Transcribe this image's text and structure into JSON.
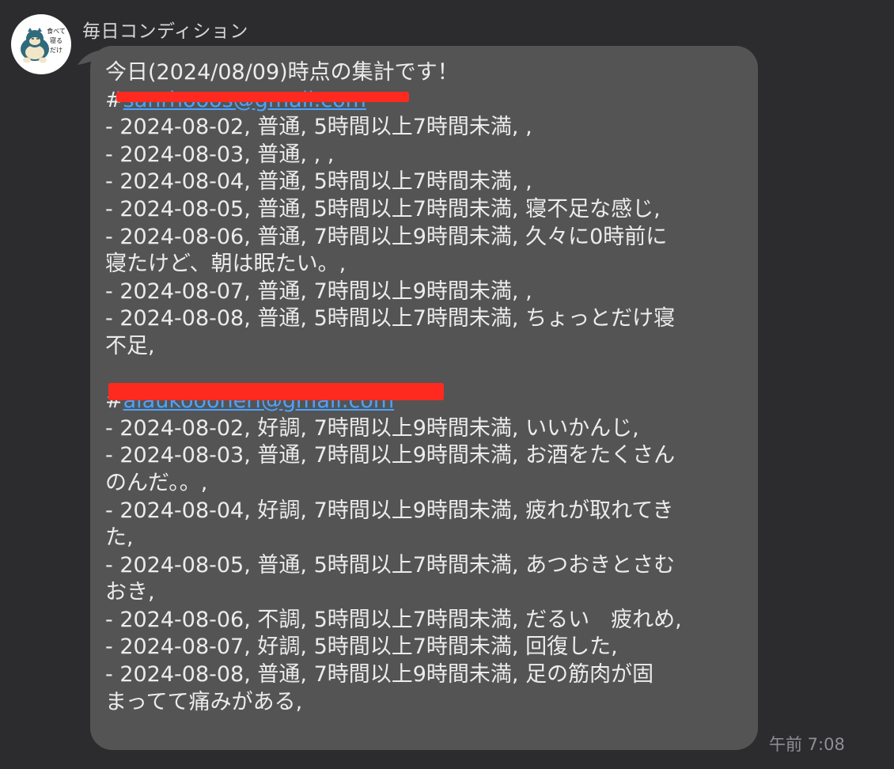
{
  "sender": {
    "name": "毎日コンディション",
    "avatar_icon": "sleeping-bear-character-icon",
    "avatar_text": "食べて寝るだけ"
  },
  "message": {
    "lines": [
      {
        "text": "今日(2024/08/09)時点の集計です！"
      },
      {
        "prefix": "#",
        "link": "sanrhooos@gmail.com",
        "redacted": true
      },
      {
        "text": "- 2024-08-02, 普通, 5時間以上7時間未満, ,"
      },
      {
        "text": "- 2024-08-03, 普通, , ,"
      },
      {
        "text": "- 2024-08-04, 普通, 5時間以上7時間未満, ,"
      },
      {
        "text": "- 2024-08-05, 普通, 5時間以上7時間未満, 寝不足な感じ,"
      },
      {
        "text": "- 2024-08-06, 普通, 7時間以上9時間未満, 久々に0時前に"
      },
      {
        "text": "寝たけど、朝は眠たい。,"
      },
      {
        "text": "- 2024-08-07, 普通, 7時間以上9時間未満, ,"
      },
      {
        "text": "- 2024-08-08, 普通, 5時間以上7時間未満, ちょっとだけ寝"
      },
      {
        "text": "不足,"
      },
      {
        "text": ""
      },
      {
        "prefix": "#",
        "link": "aiaukoooheri@gmail.com",
        "redacted": true
      },
      {
        "text": "- 2024-08-02, 好調, 7時間以上9時間未満, いいかんじ,"
      },
      {
        "text": "- 2024-08-03, 普通, 7時間以上9時間未満, お酒をたくさん"
      },
      {
        "text": "のんだ。。,"
      },
      {
        "text": "- 2024-08-04, 好調, 7時間以上9時間未満, 疲れが取れてき"
      },
      {
        "text": "た,"
      },
      {
        "text": "- 2024-08-05, 普通, 5時間以上7時間未満, あつおきとさむ"
      },
      {
        "text": "おき,"
      },
      {
        "text": "- 2024-08-06, 不調, 5時間以上7時間未満, だるい　疲れめ,"
      },
      {
        "text": "- 2024-08-07, 好調, 5時間以上7時間未満, 回復した,"
      },
      {
        "text": "- 2024-08-08, 普通, 7時間以上9時間未満, 足の筋肉が固"
      },
      {
        "text": "まってて痛みがある,"
      }
    ]
  },
  "timestamp": "午前 7:08",
  "colors": {
    "background": "#2c2c2e",
    "bubble": "#545454",
    "text": "#ececec",
    "link": "#4aa3ff",
    "redaction": "#ff2a1f",
    "meta": "#8e8e93"
  }
}
